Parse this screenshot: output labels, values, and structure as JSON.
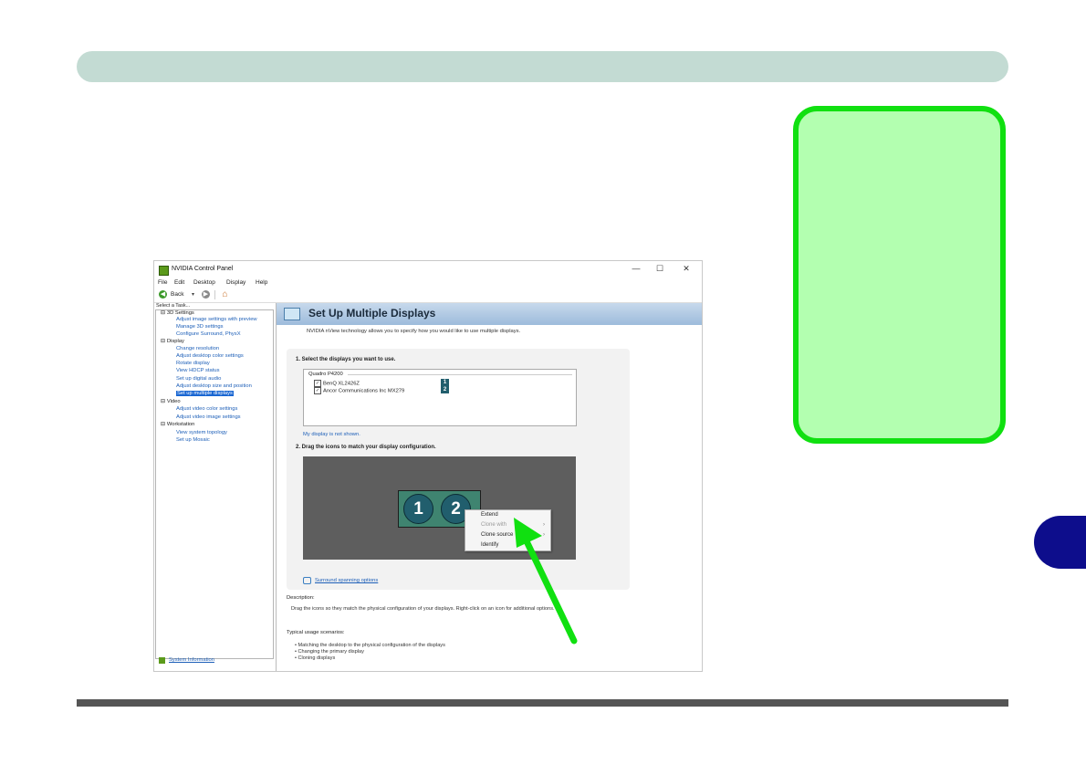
{
  "colors": {
    "header_bar": "#c3dbd3",
    "note_fill": "#b3ffb0",
    "note_border": "#10e010",
    "chapter_tab": "#0d0d8c",
    "arrow": "#10e010",
    "banner": "#9dbbdb",
    "selection": "#1966d2"
  },
  "window": {
    "title": "NVIDIA Control Panel",
    "buttons": {
      "minimize": "—",
      "maximize": "☐",
      "close": "✕"
    },
    "menu": [
      "File",
      "Edit",
      "Desktop",
      "Display",
      "Help"
    ],
    "toolbar": {
      "back_label": "Back",
      "dropdown": "▾",
      "back_icon": "arrow-left-icon",
      "forward_icon": "arrow-right-icon",
      "home_icon": "home-icon"
    }
  },
  "sidebar": {
    "heading": "Select a Task...",
    "tree": [
      {
        "label": "3D Settings",
        "kind": "category"
      },
      {
        "label": "Adjust image settings with preview",
        "kind": "link"
      },
      {
        "label": "Manage 3D settings",
        "kind": "link"
      },
      {
        "label": "Configure Surround, PhysX",
        "kind": "link"
      },
      {
        "label": "Display",
        "kind": "category"
      },
      {
        "label": "Change resolution",
        "kind": "link"
      },
      {
        "label": "Adjust desktop color settings",
        "kind": "link"
      },
      {
        "label": "Rotate display",
        "kind": "link"
      },
      {
        "label": "View HDCP status",
        "kind": "link"
      },
      {
        "label": "Set up digital audio",
        "kind": "link"
      },
      {
        "label": "Adjust desktop size and position",
        "kind": "link"
      },
      {
        "label": "Set up multiple displays",
        "kind": "selected"
      },
      {
        "label": "Video",
        "kind": "category"
      },
      {
        "label": "Adjust video color settings",
        "kind": "link"
      },
      {
        "label": "Adjust video image settings",
        "kind": "link"
      },
      {
        "label": "Workstation",
        "kind": "category"
      },
      {
        "label": "View system topology",
        "kind": "link"
      },
      {
        "label": "Set up Mosaic",
        "kind": "link"
      }
    ],
    "system_info": "System Information"
  },
  "main": {
    "title": "Set Up Multiple Displays",
    "intro": "NVIDIA nView technology allows you to specify how you would like to use multiple displays.",
    "step1": "1. Select the displays you want to use.",
    "gpu": "Quadro P4200",
    "displays": [
      {
        "name": "BenQ XL2426Z",
        "number": "1",
        "checked": true
      },
      {
        "name": "Ancor Communications Inc MX279",
        "number": "2",
        "checked": true
      }
    ],
    "not_shown_link": "My display is not shown.",
    "step2": "2. Drag the icons to match your display configuration.",
    "monitors": [
      "1",
      "2"
    ],
    "context_menu": [
      {
        "label": "Extend",
        "enabled": true,
        "submenu": false
      },
      {
        "label": "Clone with",
        "enabled": false,
        "submenu": true
      },
      {
        "label": "Clone source",
        "enabled": true,
        "submenu": true
      },
      {
        "label": "Identify",
        "enabled": true,
        "submenu": false
      }
    ],
    "surround_link": "Surround spanning options",
    "description_heading": "Description:",
    "description": "Drag the icons so they match the physical configuration of your displays. Right-click on an icon for additional options.",
    "usage_heading": "Typical usage scenarios:",
    "usage": [
      "• Matching the desktop to the physical configuration of the displays",
      "• Changing the primary display",
      "• Cloning displays"
    ]
  }
}
